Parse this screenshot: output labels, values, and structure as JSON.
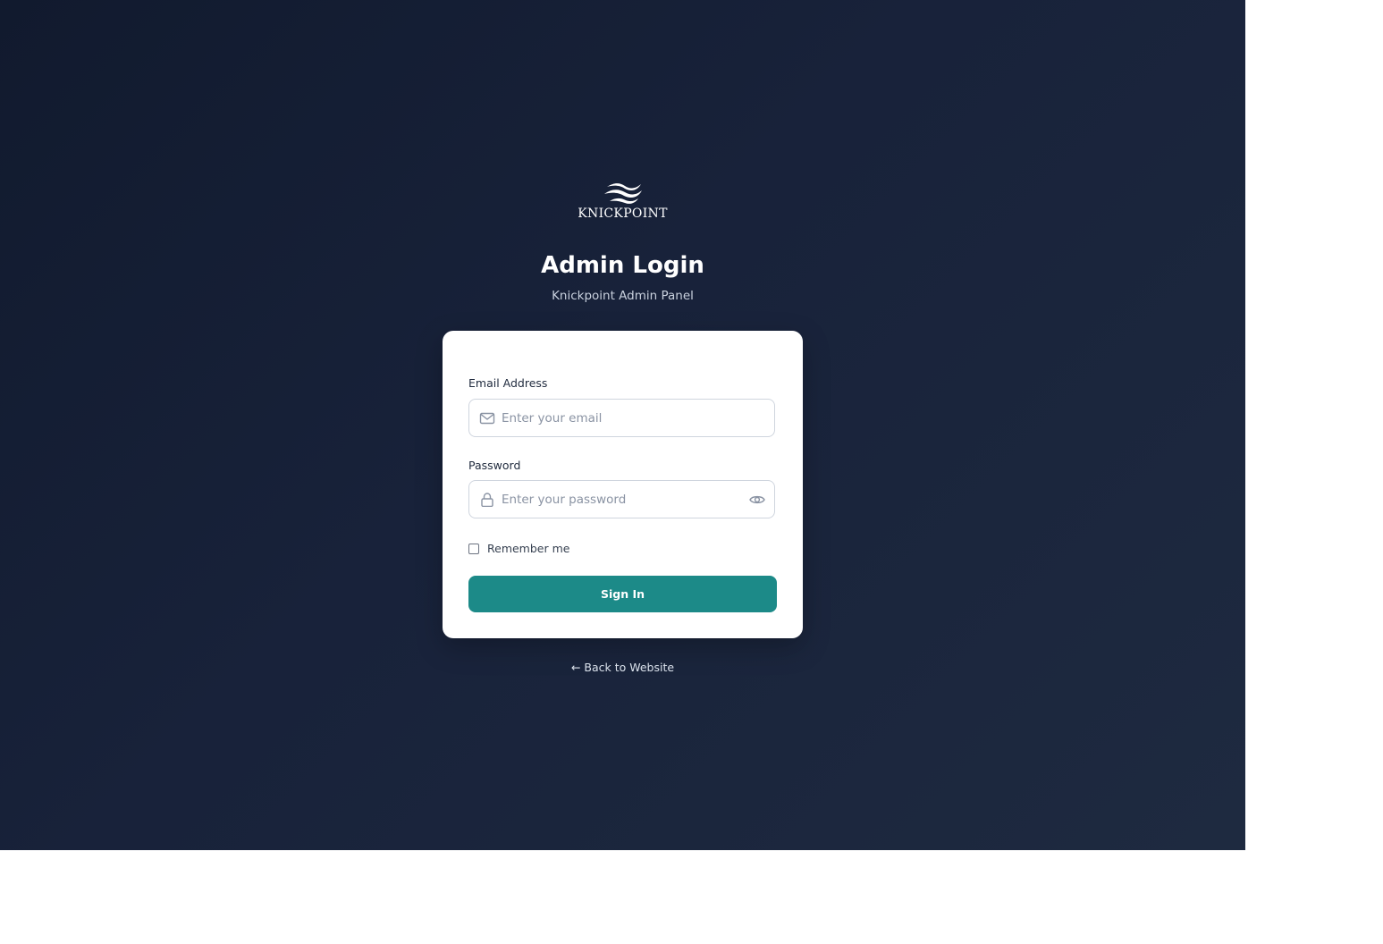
{
  "brand": {
    "wordmark": "KNICKPOINT",
    "logo_icon": "waves-icon"
  },
  "header": {
    "title": "Admin Login",
    "subtitle": "Knickpoint Admin Panel"
  },
  "form": {
    "email": {
      "label": "Email Address",
      "placeholder": "Enter your email",
      "value": "",
      "icon": "mail-icon"
    },
    "password": {
      "label": "Password",
      "placeholder": "Enter your password",
      "value": "",
      "icon": "lock-icon",
      "toggle_icon": "eye-icon"
    },
    "remember": {
      "label": "Remember me",
      "checked": false
    },
    "submit_label": "Sign In"
  },
  "footer": {
    "back_link": "← Back to Website"
  },
  "colors": {
    "background_start": "#111a2e",
    "background_end": "#1e2a40",
    "card": "#ffffff",
    "primary_button": "#1c8a88",
    "text_dark": "#1f2a3d",
    "placeholder": "#8a93a3"
  }
}
